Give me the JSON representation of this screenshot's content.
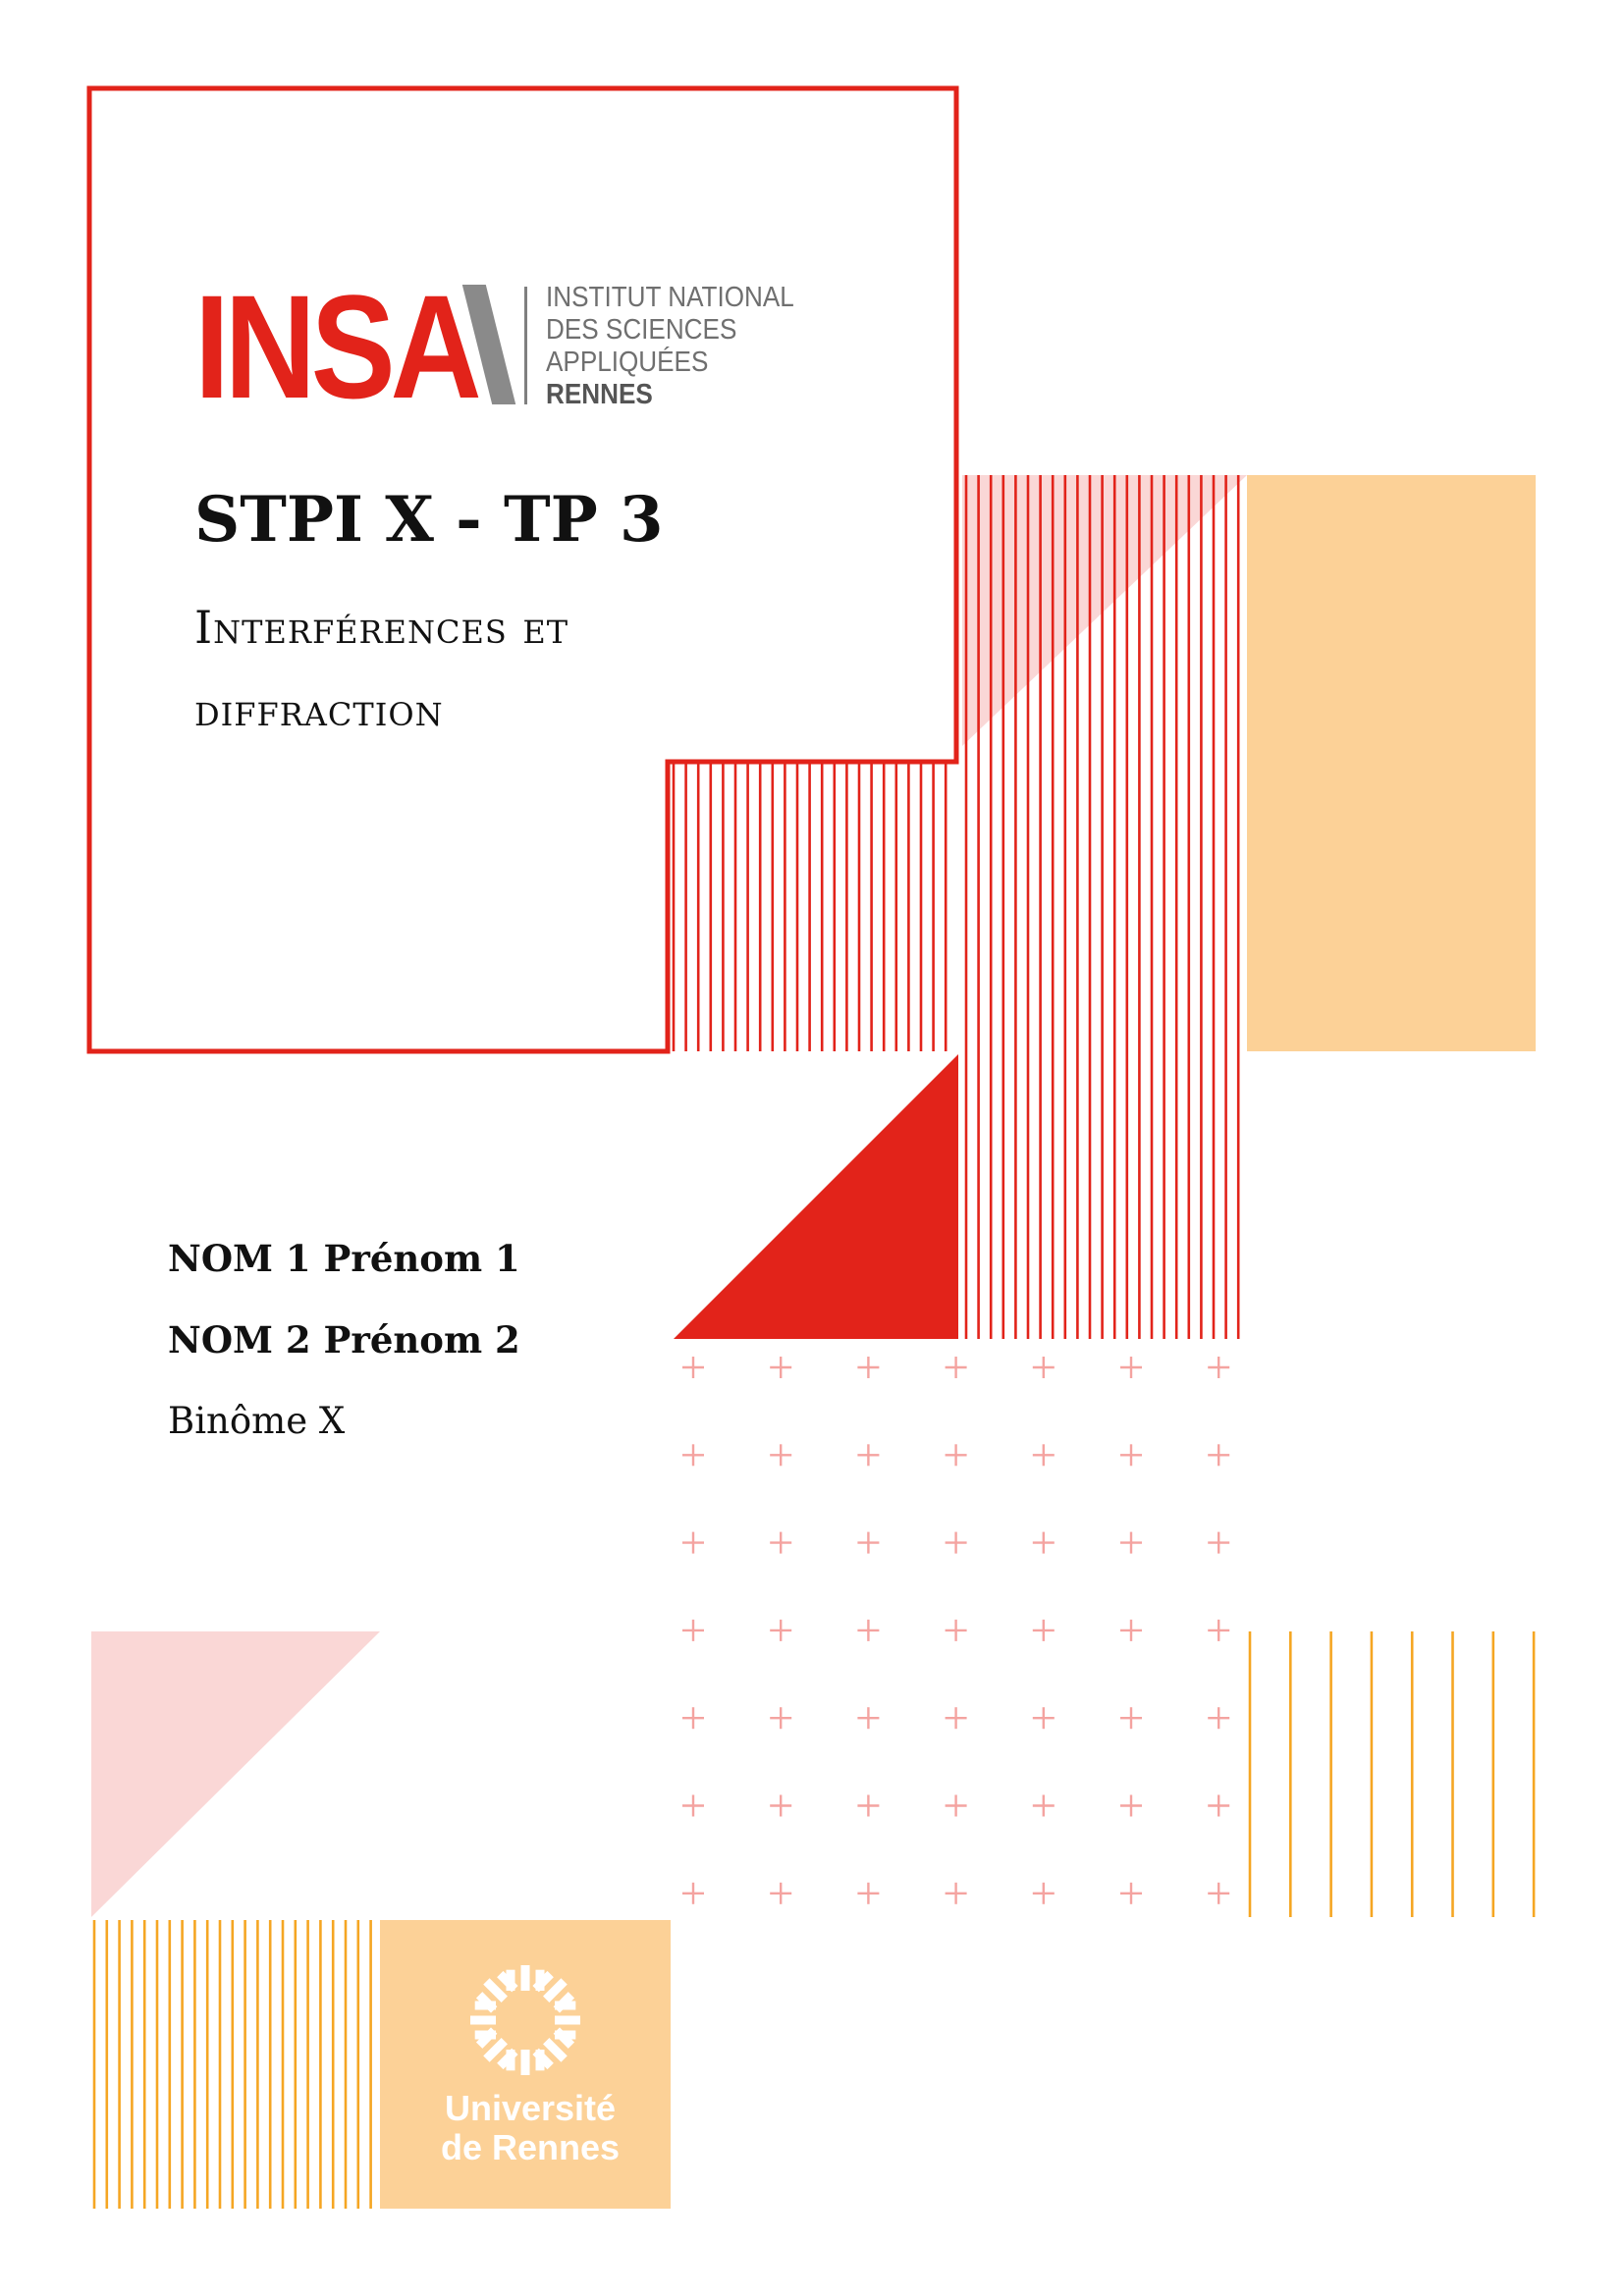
{
  "document": {
    "title": "STPI X - TP 3",
    "subtitle_line_1": "Interférences et",
    "subtitle_line_2": "diffraction"
  },
  "students": [
    {
      "label": "NOM 1 Prénom 1"
    },
    {
      "label": "NOM 2 Prénom 2"
    }
  ],
  "group_label": "Binôme X",
  "insa_logo": {
    "wordmark": "INSA",
    "line_1": "INSTITUT NATIONAL",
    "line_2": "DES SCIENCES",
    "line_3": "APPLIQUÉES",
    "line_4": "RENNES"
  },
  "university_logo": {
    "line_1": "Université",
    "line_2": "de Rennes"
  },
  "colors": {
    "red": "#e2231a",
    "orange_light": "#fcd197",
    "orange_line": "#f5a623",
    "pink": "#fad7d6"
  }
}
